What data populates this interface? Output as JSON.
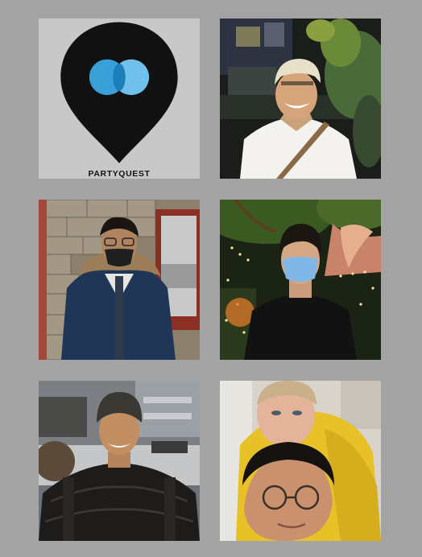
{
  "logo": {
    "text": "PARTYQUEST",
    "icon": "map-pin-icon",
    "pin_color": "#111111",
    "dot_color": "#3aa0d8"
  },
  "photos": [
    {
      "name": "photo-man-white-shirt-cap",
      "description": ""
    },
    {
      "name": "photo-man-glasses-mask-jacket"
    },
    {
      "name": "photo-man-mask-lights"
    },
    {
      "name": "photo-man-beanie-puffer"
    },
    {
      "name": "photo-two-men-yellow"
    }
  ]
}
